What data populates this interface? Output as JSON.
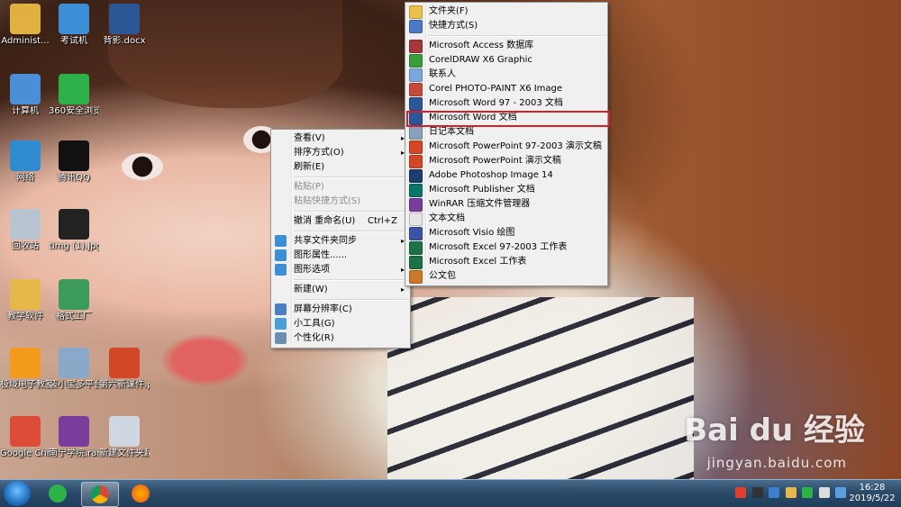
{
  "desktop": {
    "icons": [
      {
        "label": "Administ...",
        "icon": "user-folder-icon",
        "color": "#e0b040"
      },
      {
        "label": "考试机",
        "icon": "monitor-icon",
        "color": "#3a8fd6"
      },
      {
        "label": "背影.docx",
        "icon": "word-doc-icon",
        "color": "#2b5797"
      },
      {
        "label": "计算机",
        "icon": "computer-icon",
        "color": "#4a90d9"
      },
      {
        "label": "360安全浏览器",
        "icon": "360-browser-icon",
        "color": "#2db24a"
      },
      {
        "label": "网络",
        "icon": "network-globe-icon",
        "color": "#2e8bd0"
      },
      {
        "label": "腾讯QQ",
        "icon": "qq-penguin-icon",
        "color": "#111111"
      },
      {
        "label": "回收站",
        "icon": "recycle-bin-icon",
        "color": "#b8c4cf"
      },
      {
        "label": "timg (1).jpg",
        "icon": "image-file-icon",
        "color": "#222222"
      },
      {
        "label": "教学软件",
        "icon": "folder-icon",
        "color": "#e6b84a"
      },
      {
        "label": "格式工厂",
        "icon": "format-factory-icon",
        "color": "#3c9b5b"
      },
      {
        "label": "极域电子教室软件 v4...",
        "icon": "classroom-software-icon",
        "color": "#f29b1c"
      },
      {
        "label": "装小宝多平台助手 30...",
        "icon": "cd-disc-icon",
        "color": "#8aa9c9"
      },
      {
        "label": "第六新课件.pptx",
        "icon": "ppt-doc-icon",
        "color": "#d24726"
      },
      {
        "label": "Google Chrome",
        "icon": "chrome-icon",
        "color": "#dd4b39"
      },
      {
        "label": "南宁学院.rar",
        "icon": "winrar-icon",
        "color": "#7a3d9b"
      },
      {
        "label": "新建文件夹超级数据...",
        "icon": "file-icon",
        "color": "#cfd8e2"
      }
    ]
  },
  "context_menu": {
    "items": [
      {
        "label": "查看(V)",
        "arrow": "▸",
        "disabled": false
      },
      {
        "label": "排序方式(O)",
        "arrow": "▸",
        "disabled": false
      },
      {
        "label": "刷新(E)",
        "disabled": false
      },
      {
        "label": "粘贴(P)",
        "disabled": true
      },
      {
        "label": "粘贴快捷方式(S)",
        "disabled": true
      },
      {
        "label": "撤消 重命名(U)",
        "shortcut": "Ctrl+Z",
        "disabled": false
      },
      {
        "label": "共享文件夹同步",
        "arrow": "▸",
        "disabled": false
      },
      {
        "label": "图形属性......",
        "disabled": false
      },
      {
        "label": "图形选项",
        "arrow": "▸",
        "disabled": false
      },
      {
        "label": "新建(W)",
        "arrow": "▸",
        "disabled": false
      },
      {
        "label": "屏幕分辨率(C)",
        "disabled": false
      },
      {
        "label": "小工具(G)",
        "disabled": false
      },
      {
        "label": "个性化(R)",
        "disabled": false
      }
    ]
  },
  "new_submenu": {
    "items": [
      {
        "label": "文件夹(F)",
        "color": "#e8c04a"
      },
      {
        "label": "快捷方式(S)",
        "color": "#4a79c8"
      },
      {
        "label": "Microsoft Access 数据库",
        "color": "#a4373a"
      },
      {
        "label": "CorelDRAW X6 Graphic",
        "color": "#3a9b3a"
      },
      {
        "label": "联系人",
        "color": "#7aa7d9"
      },
      {
        "label": "Corel PHOTO-PAINT X6 Image",
        "color": "#c64a3a"
      },
      {
        "label": "Microsoft Word 97 - 2003 文档",
        "color": "#2b5797"
      },
      {
        "label": "Microsoft Word 文档",
        "color": "#2b5797"
      },
      {
        "label": "日记本文档",
        "color": "#8aa1bb"
      },
      {
        "label": "Microsoft PowerPoint 97-2003 演示文稿",
        "color": "#d24726"
      },
      {
        "label": "Microsoft PowerPoint 演示文稿",
        "color": "#d24726"
      },
      {
        "label": "Adobe Photoshop Image 14",
        "color": "#1c3d6e"
      },
      {
        "label": "Microsoft Publisher 文档",
        "color": "#077568"
      },
      {
        "label": "WinRAR 压缩文件管理器",
        "color": "#7a3d9b"
      },
      {
        "label": "文本文档",
        "color": "#e6e6e6"
      },
      {
        "label": "Microsoft Visio 绘图",
        "color": "#3955a3"
      },
      {
        "label": "Microsoft Excel 97-2003 工作表",
        "color": "#1e7145"
      },
      {
        "label": "Microsoft Excel 工作表",
        "color": "#1e7145"
      },
      {
        "label": "公文包",
        "color": "#c87a2a"
      }
    ]
  },
  "taskbar": {
    "time": "16:28",
    "date": "2019/5/22"
  },
  "watermark": {
    "text": "Bai du 经验",
    "url": "jingyan.baidu.com"
  }
}
